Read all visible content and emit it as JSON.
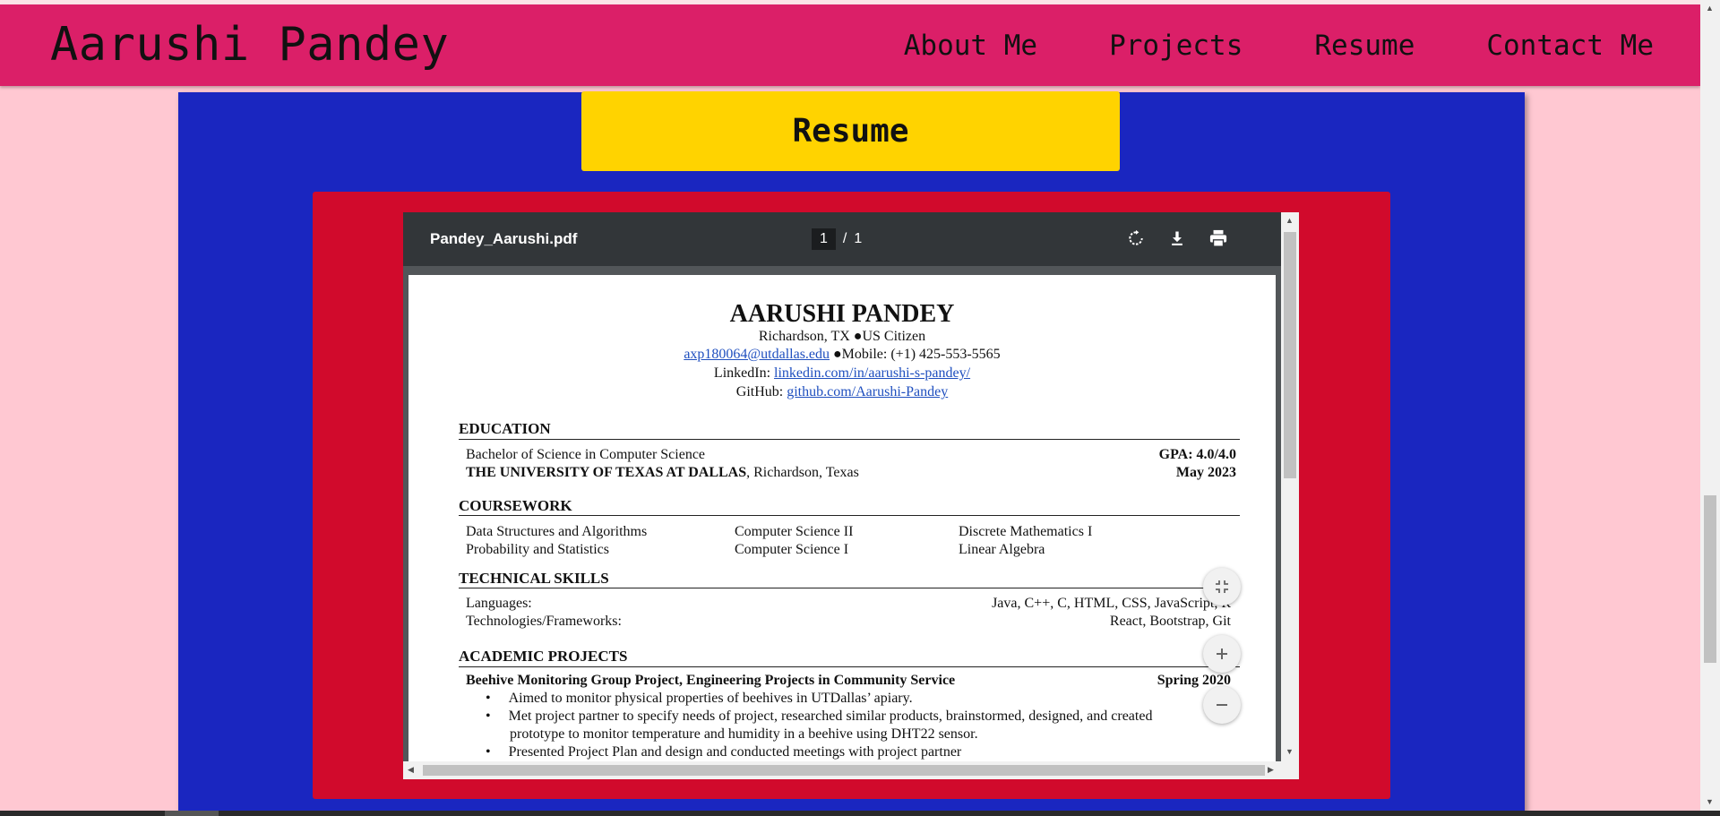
{
  "brand": "Aarushi Pandey",
  "nav": [
    "About Me",
    "Projects",
    "Resume",
    "Contact Me"
  ],
  "section_title": "Resume",
  "viewer": {
    "filename": "Pandey_Aarushi.pdf",
    "page_current": "1",
    "page_sep": "/",
    "page_total": "1",
    "icons": [
      "rotate-icon",
      "download-icon",
      "print-icon"
    ]
  },
  "resume": {
    "name": "AARUSHI PANDEY",
    "contact_line1": "Richardson, TX ●US Citizen",
    "email": "axp180064@utdallas.edu",
    "mobile": " ●Mobile: (+1) 425-553-5565",
    "linkedin_label": "LinkedIn: ",
    "linkedin": "linkedin.com/in/aarushi-s-pandey/",
    "github_label": "GitHub: ",
    "github": "github.com/Aarushi-Pandey",
    "education_heading": "EDUCATION",
    "degree": "Bachelor of Science in Computer Science",
    "gpa": "GPA: 4.0/4.0",
    "university": "THE UNIVERSITY OF TEXAS AT DALLAS",
    "university_loc": ", Richardson, Texas",
    "grad_date": "May 2023",
    "coursework_heading": "COURSEWORK",
    "courses": [
      "Data Structures and Algorithms",
      "Computer Science II",
      "Discrete Mathematics I",
      "Probability and Statistics",
      "Computer Science I",
      "Linear Algebra"
    ],
    "skills_heading": "TECHNICAL SKILLS",
    "languages_label": "Languages:",
    "languages": "Java, C++, C, HTML, CSS, JavaScript, R",
    "tech_label": "Technologies/Frameworks:",
    "tech": "React, Bootstrap, Git",
    "projects_heading": "ACADEMIC PROJECTS",
    "project_title": "Beehive Monitoring Group Project, Engineering Projects in Community Service",
    "project_date": "Spring 2020",
    "bullets": [
      "Aimed to monitor physical properties of beehives in UTDallas’ apiary.",
      "Met project partner to specify needs of project, researched similar products, brainstormed, designed, and created",
      "prototype to monitor temperature and humidity in a beehive using DHT22 sensor.",
      "Presented Project Plan and design and conducted meetings with project partner"
    ]
  },
  "zoom_controls": [
    "fit-page-icon",
    "zoom-in-icon",
    "zoom-out-icon"
  ]
}
